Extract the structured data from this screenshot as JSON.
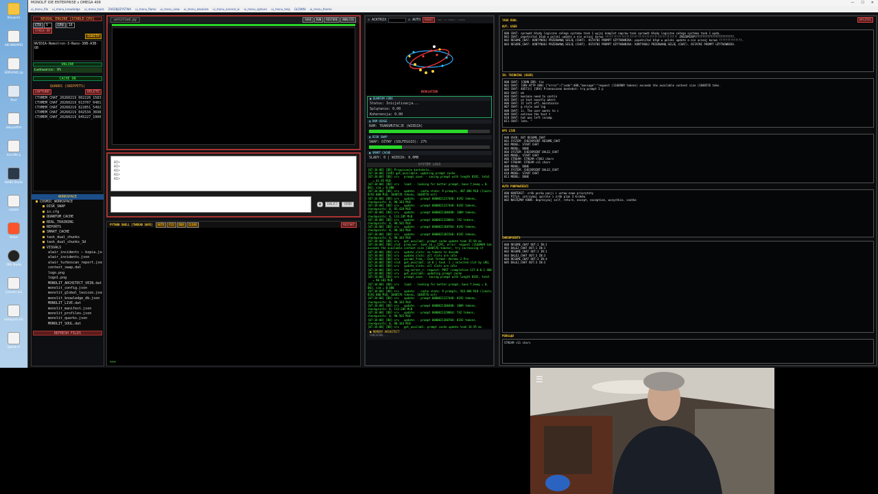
{
  "desktop_icons": [
    {
      "label": "Blueprint",
      "icon": "folder-icon"
    },
    {
      "label": "ANI INNAPRO",
      "icon": "file-icon"
    },
    {
      "label": "SDM3ANO_sp",
      "icon": "file-icon"
    },
    {
      "label": "Kosz",
      "icon": "recycle-bin-icon"
    },
    {
      "label": "alwaysdfrm",
      "icon": "file-icon"
    },
    {
      "label": "docxdlls-p",
      "icon": "file-icon"
    },
    {
      "label": "NetBit Studio",
      "icon": "app-icon"
    },
    {
      "label": "notatki",
      "icon": "file-icon"
    },
    {
      "label": "Brave",
      "icon": "brave-icon"
    },
    {
      "label": "OBS Studio",
      "icon": "obs-icon"
    },
    {
      "label": "nanoacc.ext",
      "icon": "file-icon"
    },
    {
      "label": "kodapicnt.ext",
      "icon": "file-icon"
    },
    {
      "label": "openai.ic",
      "icon": "file-icon"
    }
  ],
  "window": {
    "title": "MONOLIT IDE ENTERPRISE v OMEGA 408",
    "controls": [
      "—",
      "☐",
      "✕"
    ]
  },
  "menu": [
    "ui_menu_file",
    "ui_menu_knowledge",
    "ui_menu_tools",
    "ZARZĄDZYSTWA",
    "ui_menu_flame",
    "ui_menu_view",
    "ui_menu_absolute",
    "ui_menu_arsenal_ai",
    "ui_menu_options",
    "ui_menu_help",
    "GŁÓWNI",
    "ui_menu_theme"
  ],
  "left": {
    "engine_title": "NEURAL ENGINE [STABLE-CPU]",
    "ctx_label": "CTX",
    "ctx_value": "5",
    "cpu_label": "CPU",
    "cpu_value": "16",
    "stable_badge": "STABLE-ON",
    "ignite": "IGNITE",
    "model": "NVIDIA-Nemotron-3-Nano-30B-A3B-Q8",
    "online": "ONLINE",
    "loading": "Ładowanie: 0%",
    "cache_on": "CACHE ON",
    "quarks_title": "QUARKS (SNIPPETS)",
    "capture": "CAPTURE",
    "delete": "DELETE",
    "snippets": [
      "CTXMEM_CHAT_20260219_002220_1583",
      "CTXMEM_CHAT_20260219_013707_0481",
      "CTXMEM_CHAT_20260219_022851_5492",
      "CTXMEM_CHAT_20260219_042534_3698",
      "CTXMEM_CHAT_20260219_045227_1900"
    ],
    "workspace_title": "WORKSPACE",
    "files": [
      "COSMIC_WORKSPACE",
      "DISK_SWAP",
      "in.cfg",
      "QUANTUM_CACHE",
      "REAL_TRAINING",
      "REPORTS",
      "SMART_CACHE",
      "task_dual_chunks",
      "task_dual_chunks_3d",
      "VISUALS",
      "alwir_incidents — kopia.json",
      "alwir_incidents.json",
      "alwir_turboscan_report.json",
      "context_swap.dat",
      "logo.png",
      "logo1.png",
      "MONOLIT_ARCHITECT_VEIN.dat",
      "monolit_config.json",
      "monolit_global_lexicon.json",
      "monolit_knowledge_db.json",
      "MONOLIT_LIVE.dat",
      "monolit_manifest.json",
      "monolit_profiles.json",
      "monolit_quarks.json",
      "MONOLIT_SOUL.dat"
    ],
    "refresh": "REFRESH FILES"
  },
  "editor": {
    "tab": "untitled.py",
    "tools": [
      "SAVE",
      "RUN",
      "RESTORE",
      "ANALYZE"
    ]
  },
  "chat": {
    "lines": [
      "AI>",
      "AI>",
      "AI>",
      "AI>",
      "AI>"
    ],
    "input_placeholder": "",
    "dalej": "DALEJ",
    "send": "SEND"
  },
  "shell": {
    "title": "PYTHON SHELL [THREAD SAFE]",
    "buttons": [
      "AUTO",
      "FIX",
      "RUN",
      "CLEAR"
    ],
    "reset": "RESTART",
    "prompt": ">>>"
  },
  "monitor": {
    "actrix": "ACKTRIX",
    "auto": "AUTO",
    "reset": "RESET",
    "status_hint": "PRC: 71  SYMBOL: LOCKED",
    "revelation": "REVELATION",
    "quantum_title": "QUANTUM CORE",
    "status": "Status: Inicjalizacja...",
    "splatanie": "Splątanie: 0.00",
    "koherencja": "Koherencja: 0.00",
    "ram_title": "RAM USAGE",
    "ram_text": "RAM: TRANSMUTACJE (WIEDZA)",
    "ram_fill": 0.82,
    "disk_title": "DISK SWAP",
    "disk_text": "SWAP: OŻYWY (SOLFEGGIO): 27%",
    "disk_fill": 0.27,
    "cache_title": "SMART CACHE",
    "cache_text": "SLADY: 0 | WIEDZA: 0.0MB",
    "logs_title": "SYSTEM LOGS",
    "architect": "MEMORY ARCHITECT",
    "architect_status": "CHECKING..."
  },
  "syslog": [
    "[07:34:08] [DB] Przypisanie kontekstu...",
    "[07:34:08] [SVR] get_available: updating prompt cache",
    "[07:34:08] [DB] srv   prompt_save: - saving prompt with length 8192, total state",
    "   = 41.95 MiB",
    "[07:34:08] [DB] srv   load: - looking for better prompt, base f_keep = 0.",
    "001, sim = 0.000",
    "[07:34:08] [DB] srv   update: - cache state: 9 prompts, 487.096 MiB (limits:",
    "8192.000 MiB, 1048576 tokens, 1048576 est)",
    "[07:34:08] [DB] srv   update: - prompt 0000021237448: 8192 tokens,",
    "checkpoints: 0, 90.183 MiB",
    "[07:34:08] [DB] srv   update: - prompt 0000021237448: 8192 tokens,",
    "checkpoints: 0, 93.438 MiB",
    "[07:34:08] [DB] srv   update: - prompt 0000021300480: 1009 tokens,",
    "checkpoints: 0, 113.285 MiB",
    "[07:34:08] [DB] srv   update: - prompt 0000021328064: 742 tokens,",
    "checkpoints: 0, 90.565 MiB",
    "[07:34:08] [DB] srv   update: - prompt 0000021388704: 8192 tokens,",
    "checkpoints: 0, 90.183 MiB",
    "[07:34:08] [DB] srv   update: - prompt 0000021381560: 8192 tokens,",
    "checkpoints: 0, 90.183 MiB",
    "[07:34:08] [DB] srv   get_availabl: prompt cache update took 35.94 ms",
    "[07:34:08] [DB] slot  prom_ver: task id = 2291, error: request (1168909 tokens)",
    "exceeds the available context size (1048576 tokens), try increasing it",
    "[07:34:08] [DB] srv   update_slots: no tokens to decode",
    "[07:34:08] [DB] srv   update_slots: all slots are idle",
    "[07:34:08] [DB] srv   params_from_: Chat format: Hermes 2 Pro",
    "[07:34:08] [DB] slot  get_availabl: id 0 | task -1 | selected slot by LRU,",
    "[07:34:08] [DB] srv   update_slots: all slots are idle",
    "[07:34:08] [DB] srv   log_server_r: request: POST /completion 127.0.0.1 400",
    "[07:34:08] [DB] srv   get_availabl: updating prompt cache",
    "[07:34:08] [DB] srv   prompt_save: - saving prompt with length 8192, total state",
    "   = 90.183 MiB",
    "[07:34:08] [DB] srv   load: - looking for better prompt, base f_keep = 0.",
    "001, sim = 0.000",
    "[07:34:08] [DB] srv   update: - cache state: 9 prompts, 563.096 MiB (limits:",
    "8192.000 MiB, 1048576 tokens, 1048576 est)",
    "[07:34:08] [DB] srv   update: - prompt 0000021237448: 8192 tokens,",
    "checkpoints: 0, 90.183 MiB",
    "[07:34:08] [DB] srv   update: - prompt 0000021300480: 1009 tokens,",
    "checkpoints: 0, 113.285 MiB",
    "[07:34:08] [DB] srv   update: - prompt 0000021328064: 742 tokens,",
    "checkpoints: 0, 90.565 MiB",
    "[07:34:08] [DB] srv   update: - prompt 0000021388704: 8192 tokens,",
    "checkpoints: 0, 90.183 MiB",
    "[07:34:08] [DB] srv   get_availabl: prompt cache update took 34.95 ms"
  ],
  "task": {
    "title": "TASK DUAL",
    "top_button": "WYCZYŚĆ",
    "out_label": "OUT: USER",
    "out_lines": [
      "000 CHAT: sprawdź błędy logiczne całego systemu task 1 wyjaj komplet napraw task sprawdź błędy logiczne całego systemu task 1 wyda.",
      "001 CHAT: popełniłaś błąd w polski update a nie ucinaj kurwa !!!!!!!!!!!!!!!!!!!!!!!!!!!!!!!!!!!!!!!!!!!! ZROZUMIEMY???????????????????????.",
      "002 RESUME_CHAT: KONTYNUUJ PRZERWANĄ SESJĘ (CHAT). OSTATNI PROMPT UŻYTKOWNIKA: popełniłaś błąd w polski update a nie ucinaj kurwa !!!!!!!!!!!!!!.",
      "003 RESUME_CHAT: KONTYNUUJ PRZERWANĄ SESJĘ (CHAT). OSTATNI PROMPT UŻYTKOWNIKA: KONTYNUUJ PRZERWANĄ SESJĘ (CHAT). OSTATNI PROMPT UŻYTKOWNIKA."
    ],
    "thinking_label": "IN: THINKING (USER)",
    "thinking_lines": [
      "000 CHAT: [CONN ERR: tie",
      "001 CHAT: [SRV HTTP 400] {\"error\":{\"code\":400,\"message\":\"request (1168909 tokens) exceeds the available context size (1048576 toke.",
      "002 CHAT: 48573)] [SRV] Przenoszono kontekst: trą prompt 1 p",
      "003 CHAT: ok",
      "004 CHAT: musimie need to contin",
      "005 CHAT: un text exactly where",
      "006 CHAT: It left off, maintainin",
      "007 CHAT: g style and log",
      "008 CHAT: ic. The user wants to c",
      "009 CHAT: ontinue the text t",
      "010 CHAT: hat was left incomp",
      "011 CHAT: lete. \""
    ],
    "ops_label": "OPS LIVE",
    "ops_lines": [
      "000 USER: OUT RESUME_CHAT",
      "001 SYSTEM: CHECKPOINT RESUME_CHAT",
      "002 MODEL: START CHAT",
      "003 MODEL: DONE",
      "004 SYSTEM: CHECKPOINT DALEJ_CHAT",
      "005 MODEL: START CHAT",
      "006 STREAM: STREAM +7843 chars",
      "007 STREAM: STREAM +11 chars",
      "008 MODEL: DONE",
      "009 SYSTEM: CHECKPOINT DALEJ_CHAT",
      "010 MODEL: START CHAT",
      "011 MODEL: DONE"
    ],
    "kontekst_label": "AUTO PODPOWIEDZI",
    "kontekst_lines": [
      "000 KONTEKST: zrób porów pacji i ustaw nowe priorytety",
      "001 PITLA: zatrzymaj spirale i zrób plan 3 kroków",
      "002 NASTĘPNY KROK: doprecyzuj self, return, except, exception, wszystkie, szatke"
    ],
    "checkpoints_label": "CHECKPOINTS",
    "checkpoint_lines": [
      "000 RESUME_CHAT OUT:1 IN:1",
      "001 DALEJ_CHAT OUT:1 IN:1",
      "002 RESUME_CHAT OUT:1 IN:1",
      "003 DALEJ_CHAT OUT:3 IN:3",
      "004 RESUME_CHAT OUT:3 IN:4",
      "005 DALEJ_CHAT OUT:3 IN:3"
    ],
    "podglad_label": "PODGLĄD",
    "podglad_text": "STREAM +11 chars"
  }
}
